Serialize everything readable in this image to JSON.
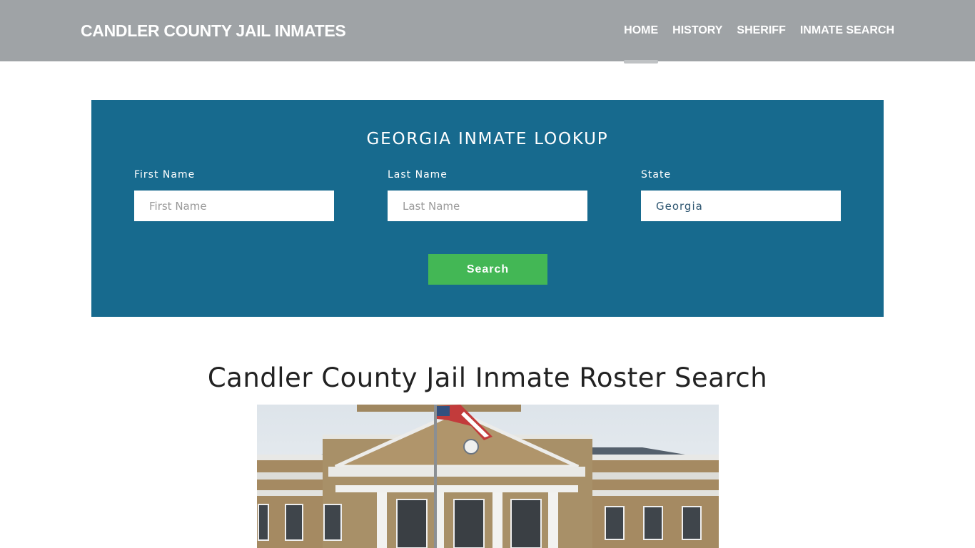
{
  "header": {
    "brand": "CANDLER COUNTY JAIL INMATES",
    "nav": [
      {
        "label": "HOME",
        "active": true
      },
      {
        "label": "HISTORY",
        "active": false
      },
      {
        "label": "SHERIFF",
        "active": false
      },
      {
        "label": "INMATE SEARCH",
        "active": false
      }
    ]
  },
  "lookup": {
    "title": "GEORGIA INMATE LOOKUP",
    "first_name": {
      "label": "First Name",
      "placeholder": "First Name",
      "value": ""
    },
    "last_name": {
      "label": "Last Name",
      "placeholder": "Last Name",
      "value": ""
    },
    "state": {
      "label": "State",
      "value": "Georgia"
    },
    "search_label": "Search"
  },
  "main": {
    "title": "Candler County Jail Inmate Roster Search",
    "image_alt": "Candler County courthouse building with flag"
  },
  "colors": {
    "navbar": "#9fa3a6",
    "lookup_bg": "#176a8e",
    "search_button": "#43b755"
  }
}
